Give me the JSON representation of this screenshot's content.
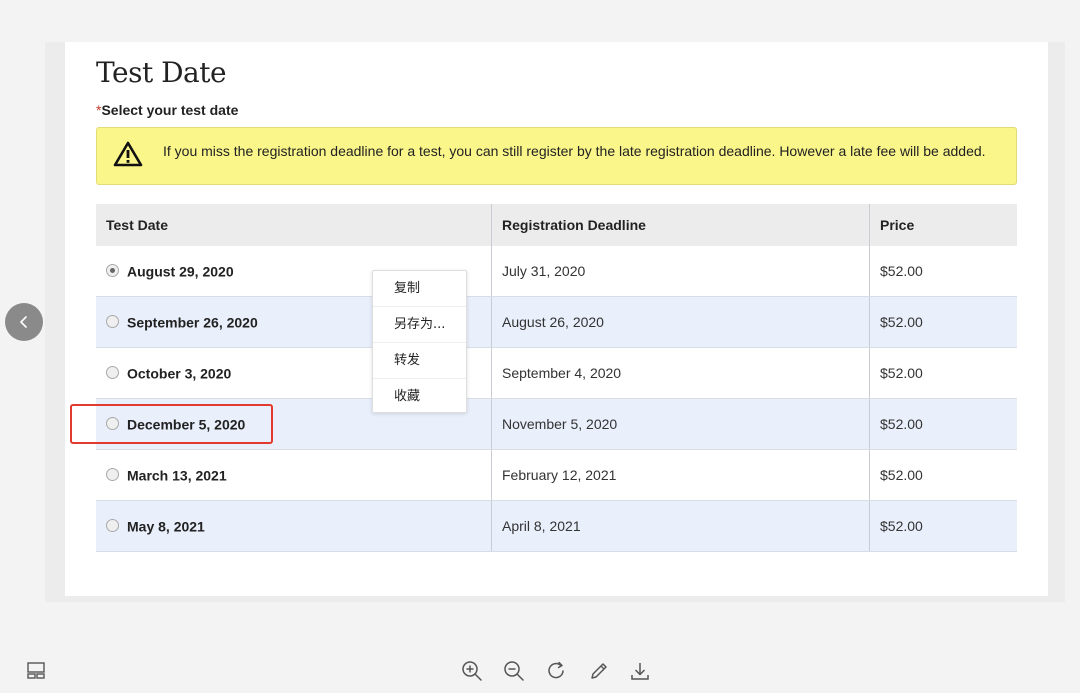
{
  "page": {
    "title": "Test Date",
    "required_mark": "*",
    "subtitle": "Select your test date"
  },
  "alert": {
    "icon": "warning-triangle-icon",
    "text": "If you miss the registration deadline for a test, you can still register by the late registration deadline. However a late fee will be added."
  },
  "table": {
    "headers": [
      "Test Date",
      "Registration Deadline",
      "Price"
    ],
    "rows": [
      {
        "test_date": "August 29, 2020",
        "deadline": "July 31, 2020",
        "price": "$52.00",
        "selected": true
      },
      {
        "test_date": "September 26, 2020",
        "deadline": "August 26, 2020",
        "price": "$52.00",
        "selected": false
      },
      {
        "test_date": "October 3, 2020",
        "deadline": "September 4, 2020",
        "price": "$52.00",
        "selected": false
      },
      {
        "test_date": "December 5, 2020",
        "deadline": "November 5, 2020",
        "price": "$52.00",
        "selected": false
      },
      {
        "test_date": "March 13, 2021",
        "deadline": "February 12, 2021",
        "price": "$52.00",
        "selected": false
      },
      {
        "test_date": "May 8, 2021",
        "deadline": "April 8, 2021",
        "price": "$52.00",
        "selected": false
      }
    ]
  },
  "context_menu": {
    "items": [
      "复制",
      "另存为...",
      "转发",
      "收藏"
    ]
  },
  "viewer": {
    "prev_icon": "chevron-left-icon",
    "toolbar_icons": [
      "zoom-in-icon",
      "zoom-out-icon",
      "rotate-icon",
      "edit-icon",
      "download-icon"
    ],
    "layout_icon": "layout-toggle-icon"
  },
  "colors": {
    "alert_bg": "#faf68a",
    "row_alt_bg": "#e9effb",
    "highlight": "#e23a2e",
    "required": "#c0392b"
  }
}
